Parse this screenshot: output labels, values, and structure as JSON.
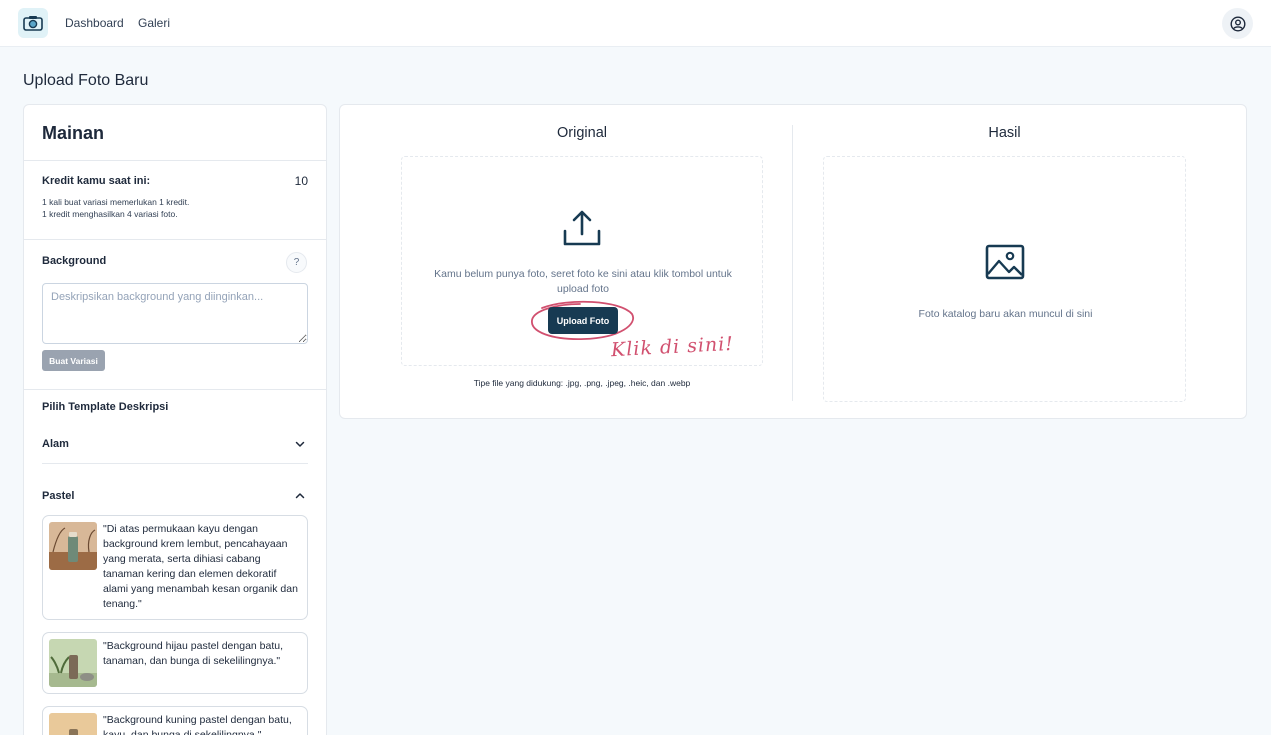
{
  "nav": {
    "links": [
      "Dashboard",
      "Galeri"
    ]
  },
  "page": {
    "title": "Upload Foto Baru"
  },
  "sidebar": {
    "title": "Mainan",
    "credit_label": "Kredit kamu saat ini:",
    "credit_value": "10",
    "credit_notes": [
      "1 kali buat variasi memerlukan 1 kredit.",
      "1 kredit menghasilkan 4 variasi foto."
    ],
    "background_label": "Background",
    "help_label": "?",
    "background_placeholder": "Deskripsikan background yang diinginkan...",
    "variasi_button": "Buat Variasi",
    "template_label": "Pilih Template Deskripsi",
    "accordions": [
      {
        "label": "Alam",
        "expanded": false
      },
      {
        "label": "Pastel",
        "expanded": true
      }
    ],
    "templates": [
      "\"Di atas permukaan kayu dengan background krem lembut, pencahayaan yang merata, serta dihiasi cabang tanaman kering dan elemen dekoratif alami yang menambah kesan organik dan tenang.\"",
      "\"Background hijau pastel dengan batu, tanaman, dan bunga di sekelilingnya.\"",
      "\"Background kuning pastel dengan batu, kayu, dan bunga di sekelilingnya.\""
    ]
  },
  "original": {
    "title": "Original",
    "drop_text": "Kamu belum punya foto, seret foto ke sini atau klik tombol untuk upload foto",
    "upload_button": "Upload Foto",
    "annotation": "Klik di sini!",
    "file_types": "Tipe file yang didukung: .jpg, .png, .jpeg, .heic, dan .webp"
  },
  "result": {
    "title": "Hasil",
    "placeholder": "Foto katalog baru akan muncul di sini"
  },
  "colors": {
    "primary": "#173a52",
    "annotation": "#d1506f",
    "disabled_button": "#9aa3b0",
    "page_bg": "#f5f9fc"
  },
  "icons": [
    "camera-icon",
    "user-circle-icon",
    "upload-icon",
    "image-icon",
    "chevron-down-icon",
    "chevron-up-icon"
  ]
}
